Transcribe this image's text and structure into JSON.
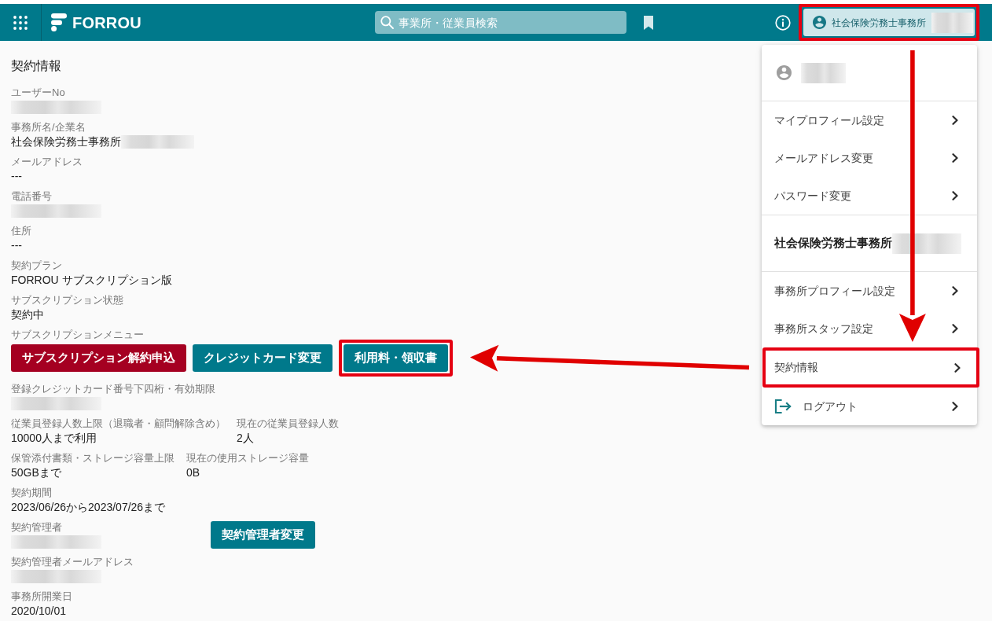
{
  "header": {
    "logo": "FORROU",
    "search": {
      "placeholder": "事業所・従業員検索"
    },
    "user_button": {
      "label": "社会保険労務士事務所",
      "redacted": true,
      "highlighted": true
    }
  },
  "contract_info": {
    "title": "契約情報",
    "items": [
      {
        "kind": "field",
        "label": "ユーザーNo",
        "redacted": true
      },
      {
        "kind": "field",
        "label": "事務所名/企業名",
        "value": "社会保険労務士事務所",
        "redacted": true
      },
      {
        "kind": "field",
        "label": "メールアドレス",
        "value": "---"
      },
      {
        "kind": "field",
        "label": "電話番号",
        "redacted": true
      },
      {
        "kind": "field",
        "label": "住所",
        "value": "---"
      },
      {
        "kind": "field",
        "label": "契約プラン",
        "value": "FORROU サブスクリプション版"
      },
      {
        "kind": "field",
        "label": "サブスクリプション状態",
        "value": "契約中"
      },
      {
        "kind": "buttons",
        "label": "サブスクリプションメニュー",
        "buttons": [
          {
            "label": "サブスクリプション解約申込",
            "color": "#a50021",
            "highlighted": false
          },
          {
            "label": "クレジットカード変更",
            "color": "#00798b",
            "highlighted": false
          },
          {
            "label": "利用料・領収書",
            "color": "#00798b",
            "highlighted": true
          }
        ]
      },
      {
        "kind": "field",
        "label": "登録クレジットカード番号下四桁・有効期限",
        "redacted": true
      },
      {
        "kind": "pair",
        "fields": [
          {
            "label": "従業員登録人数上限（退職者・顧問解除含め）",
            "value": "10000人まで利用"
          },
          {
            "label": "現在の従業員登録人数",
            "value": "2人"
          }
        ]
      },
      {
        "kind": "pair",
        "fields": [
          {
            "label": "保管添付書類・ストレージ容量上限",
            "value": "50GBまで"
          },
          {
            "label": "現在の使用ストレージ容量",
            "value": "0B"
          }
        ]
      },
      {
        "kind": "field",
        "label": "契約期間",
        "value": "2023/06/26から2023/07/26まで"
      },
      {
        "kind": "field_with_button",
        "label": "契約管理者",
        "redacted": true,
        "button": {
          "label": "契約管理者変更",
          "color": "#00798b",
          "highlighted": false
        }
      },
      {
        "kind": "field",
        "label": "契約管理者メールアドレス",
        "redacted": true
      },
      {
        "kind": "field",
        "label": "事務所開業日",
        "value": "2020/10/01"
      }
    ]
  },
  "user_menu": {
    "user": {
      "redacted": true
    },
    "sections": [
      {
        "items": [
          {
            "kind": "link",
            "label": "マイプロフィール設定",
            "highlighted": false
          },
          {
            "kind": "link",
            "label": "メールアドレス変更",
            "highlighted": false
          },
          {
            "kind": "link",
            "label": "パスワード変更",
            "highlighted": false
          }
        ]
      },
      {
        "title": "社会保険労務士事務所",
        "title_redacted": true,
        "items": [
          {
            "kind": "link",
            "label": "事務所プロフィール設定",
            "highlighted": false
          },
          {
            "kind": "link",
            "label": "事務所スタッフ設定",
            "highlighted": false
          },
          {
            "kind": "link",
            "label": "契約情報",
            "highlighted": true
          },
          {
            "kind": "logout",
            "label": "ログアウト",
            "highlighted": false
          }
        ]
      }
    ]
  },
  "callout_arrows": true
}
